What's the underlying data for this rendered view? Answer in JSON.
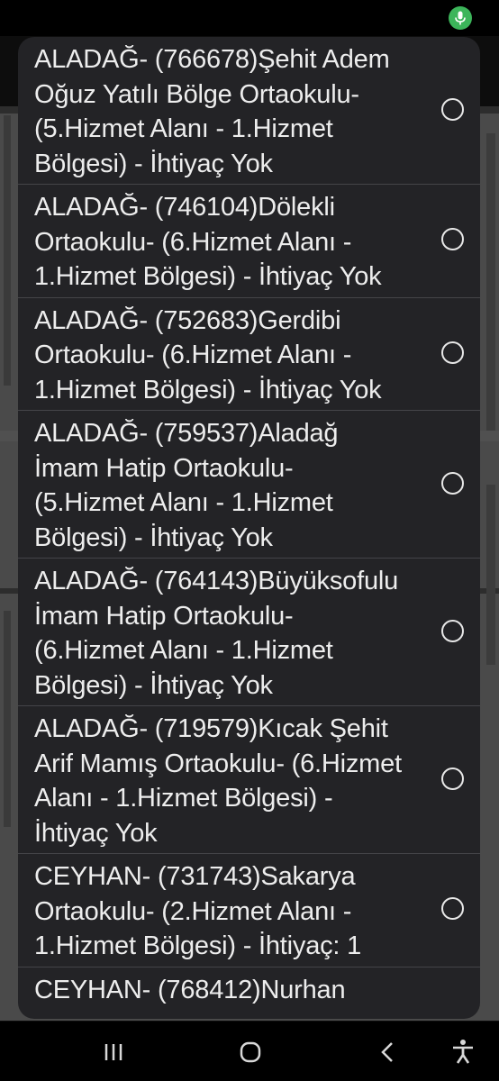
{
  "dialog": {
    "options": [
      {
        "label": "ALADAĞ- (766678)Şehit Adem Oğuz Yatılı Bölge Ortaokulu- (5.Hizmet Alanı - 1.Hizmet Bölgesi) - İhtiyaç Yok",
        "selected": false
      },
      {
        "label": "ALADAĞ- (746104)Dölekli Ortaokulu- (6.Hizmet Alanı - 1.Hizmet Bölgesi) - İhtiyaç Yok",
        "selected": false
      },
      {
        "label": "ALADAĞ- (752683)Gerdibi Ortaokulu- (6.Hizmet Alanı - 1.Hizmet Bölgesi) - İhtiyaç Yok",
        "selected": false
      },
      {
        "label": "ALADAĞ- (759537)Aladağ İmam Hatip Ortaokulu- (5.Hizmet Alanı - 1.Hizmet Bölgesi) - İhtiyaç Yok",
        "selected": false
      },
      {
        "label": "ALADAĞ- (764143)Büyüksofulu İmam Hatip Ortaokulu- (6.Hizmet Alanı - 1.Hizmet Bölgesi) - İhtiyaç Yok",
        "selected": false
      },
      {
        "label": "ALADAĞ- (719579)Kıcak Şehit Arif Mamış Ortaokulu- (6.Hizmet Alanı - 1.Hizmet Bölgesi) - İhtiyaç Yok",
        "selected": false
      },
      {
        "label": "CEYHAN- (731743)Sakarya Ortaokulu- (2.Hizmet Alanı - 1.Hizmet Bölgesi) - İhtiyaç: 1",
        "selected": false
      },
      {
        "label": "CEYHAN- (768412)Nurhan",
        "selected": false
      }
    ]
  },
  "status_bar": {
    "mic_indicator_color": "#3cb55a"
  },
  "nav_bar": {
    "icons": [
      "recent-apps-icon",
      "home-icon",
      "back-icon",
      "accessibility-icon"
    ]
  },
  "colors": {
    "dialog_bg": "#232326",
    "text": "#ededed",
    "divider": "#444448"
  }
}
